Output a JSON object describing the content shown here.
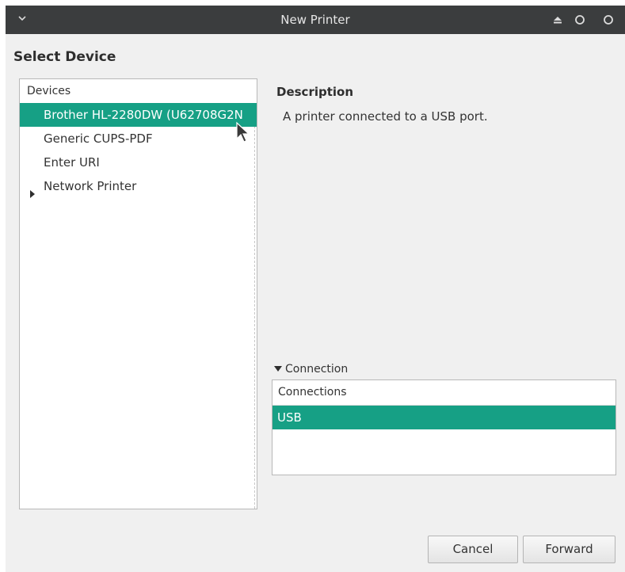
{
  "window": {
    "title": "New Printer"
  },
  "page": {
    "heading": "Select Device"
  },
  "devices": {
    "column_header": "Devices",
    "items": [
      {
        "label": "Brother HL-2280DW (U62708G2N",
        "selected": true
      },
      {
        "label": "Generic CUPS-PDF",
        "selected": false
      },
      {
        "label": "Enter URI",
        "selected": false
      },
      {
        "label": "Network Printer",
        "selected": false,
        "expandable": true,
        "expanded": false
      }
    ]
  },
  "description": {
    "title": "Description",
    "text": "A printer connected to a USB port."
  },
  "connection": {
    "expander_label": "Connection",
    "expanded": true,
    "column_header": "Connections",
    "items": [
      {
        "label": "USB",
        "selected": true
      }
    ]
  },
  "buttons": {
    "cancel": "Cancel",
    "forward": "Forward"
  },
  "colors": {
    "selection": "#16a085",
    "titlebar": "#3b3d3e",
    "window_bg": "#f0f0f0"
  },
  "icons": {
    "menu": "chevron-down-icon",
    "eject": "eject-icon",
    "minimize": "circle-icon",
    "maximize": "circle-icon",
    "tree_expander": "triangle-right-icon",
    "connection_expander": "triangle-down-icon",
    "cursor": "mouse-pointer-icon"
  }
}
